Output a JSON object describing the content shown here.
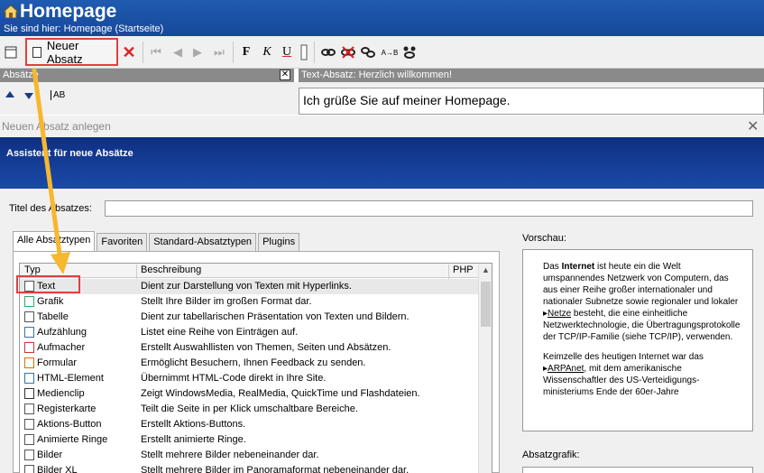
{
  "header": {
    "title": "Homepage",
    "breadcrumb": "Sie sind hier: Homepage (Startseite)"
  },
  "toolbar": {
    "new_paragraph_label": "Neuer Absatz",
    "bold": "F",
    "italic": "K",
    "underline": "U",
    "icons": [
      "page-icon",
      "delete-icon",
      "first-icon",
      "prev-icon",
      "next-icon",
      "last-icon",
      "link-icon",
      "unlink-icon",
      "link-edit-icon",
      "replace-icon",
      "anchor-icon"
    ]
  },
  "panels": {
    "left_title": "Absätze",
    "right_title": "Text-Absatz: Herzlich willkommen!",
    "text_preview": "Ich grüße Sie auf meiner Homepage.",
    "ab_icon": "AB"
  },
  "dialog": {
    "title": "Neuen Absatz anlegen",
    "banner": "Assistent für neue Absätze",
    "title_label": "Titel des Absatzes:",
    "title_value": "",
    "tabs": [
      "Alle Absatztypen",
      "Favoriten",
      "Standard-Absatztypen",
      "Plugins"
    ],
    "columns": [
      "Typ",
      "Beschreibung",
      "PHP"
    ],
    "rows": [
      {
        "name": "Text",
        "desc": "Dient zur Darstellung von Texten mit Hyperlinks."
      },
      {
        "name": "Grafik",
        "desc": "Stellt Ihre Bilder im großen Format dar."
      },
      {
        "name": "Tabelle",
        "desc": "Dient zur tabellarischen Präsentation von Texten und Bildern."
      },
      {
        "name": "Aufzählung",
        "desc": "Listet eine Reihe von Einträgen auf."
      },
      {
        "name": "Aufmacher",
        "desc": "Erstellt Auswahllisten von Themen, Seiten und Absätzen."
      },
      {
        "name": "Formular",
        "desc": "Ermöglicht Besuchern, Ihnen Feedback zu senden."
      },
      {
        "name": "HTML-Element",
        "desc": "Übernimmt HTML-Code direkt in Ihre Site."
      },
      {
        "name": "Medienclip",
        "desc": "Zeigt WindowsMedia, RealMedia, QuickTime und Flashdateien."
      },
      {
        "name": "Registerkarte",
        "desc": "Teilt die Seite in per Klick umschaltbare Bereiche."
      },
      {
        "name": "Aktions-Button",
        "desc": "Erstellt Aktions-Buttons."
      },
      {
        "name": "Animierte Ringe",
        "desc": "Erstellt animierte Ringe."
      },
      {
        "name": "Bilder",
        "desc": "Stellt mehrere Bilder nebeneinander dar."
      },
      {
        "name": "Bilder XL",
        "desc": "Stellt mehrere Bilder im Panoramaformat nebeneinander dar."
      }
    ],
    "preview_label": "Vorschau:",
    "preview_p1_a": "Das ",
    "preview_p1_b": "Internet",
    "preview_p1_c": " ist heute ein die Welt umspannendes Netzwerk von Computern, das aus einer Reihe großer internationaler und nationaler Subnetze sowie regionaler und lokaler ",
    "preview_p1_link": "Netze",
    "preview_p1_d": " besteht, die eine einheitliche Netzwerktechnologie, die Übertragungsprotokolle der TCP/IP-Familie (siehe TCP/IP), verwenden.",
    "preview_p2_a": "Keimzelle des heutigen Internet war das ",
    "preview_p2_link": "ARPAnet",
    "preview_p2_b": ", mit dem amerikanische Wissenschaftler des US-Verteidigungs-ministeriums Ende der 60er-Jahre",
    "graphic_label": "Absatzgrafik:"
  },
  "colors": {
    "header_blue": "#1f5bb0",
    "banner_blue": "#0f2f82",
    "highlight_red": "#e04040",
    "arrow_yellow": "#f5b82e"
  }
}
